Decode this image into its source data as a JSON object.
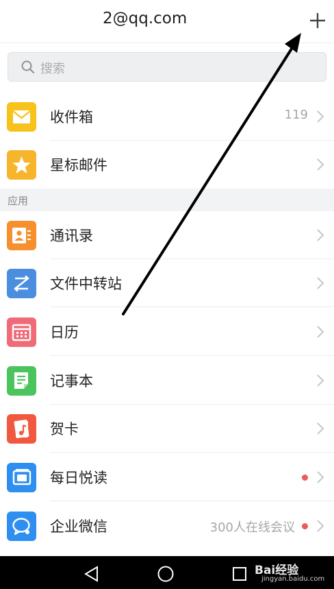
{
  "header": {
    "account": "2@qq.com",
    "add_icon": "plus-icon"
  },
  "search": {
    "placeholder": "搜索",
    "icon": "search-icon"
  },
  "mail_items": [
    {
      "label": "收件箱",
      "count": "119",
      "icon": "envelope-icon",
      "color": "#f7c21c"
    },
    {
      "label": "星标邮件",
      "icon": "star-icon",
      "color": "#f7b52c"
    }
  ],
  "section": {
    "label": "应用"
  },
  "app_items": [
    {
      "label": "通讯录",
      "icon": "contacts-icon",
      "color": "#f6902e"
    },
    {
      "label": "文件中转站",
      "icon": "transfer-icon",
      "color": "#4b8ee0"
    },
    {
      "label": "日历",
      "icon": "calendar-icon",
      "color": "#f06b77"
    },
    {
      "label": "记事本",
      "icon": "notepad-icon",
      "color": "#4cc45e"
    },
    {
      "label": "贺卡",
      "icon": "music-card-icon",
      "color": "#f0593f"
    },
    {
      "label": "每日悦读",
      "icon": "reader-icon",
      "color": "#2f8ff0",
      "badge": "dot"
    },
    {
      "label": "企业微信",
      "detail": "300人在线会议",
      "icon": "wework-icon",
      "color": "#2f8ff0",
      "badge": "dot"
    }
  ],
  "nav": {
    "back_icon": "back-triangle-icon",
    "home_icon": "home-circle-icon",
    "recent_icon": "recent-square-icon"
  },
  "watermark": {
    "brand": "Bai经验",
    "url": "jingyan.baidu.com"
  },
  "colors": {
    "badge_red": "#ec5a5c",
    "annotation_arrow": "#000000"
  }
}
